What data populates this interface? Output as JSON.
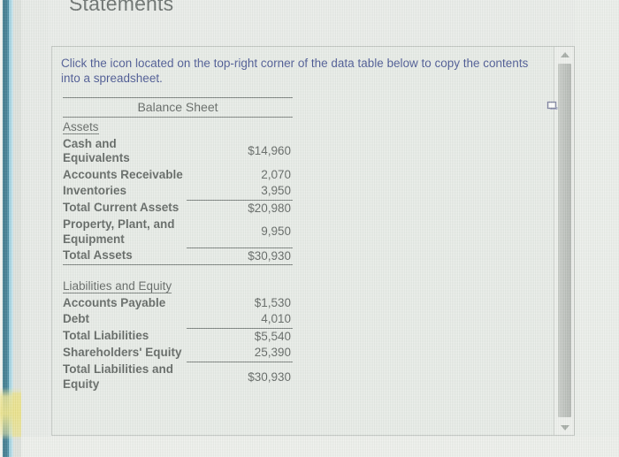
{
  "page_title": "Statements",
  "instruction": "Click the icon located on the top-right corner of the data table below to copy the contents into a spreadsheet.",
  "copy_icon": {
    "name": "copy-to-spreadsheet-icon",
    "tooltip": "Copy to spreadsheet"
  },
  "scrollbar": {
    "up_arrow": "▲",
    "down_arrow": "▼"
  },
  "colors": {
    "background": "#e5e9e4",
    "panel_border": "#b9bdb8",
    "instruction_text": "#2e3d82",
    "table_text": "#4a4f4c",
    "rule": "#6a706c",
    "edge_dark_blue": "#1d6179",
    "edge_light_blue": "#a9d7e5",
    "highlight_yellow": "#e9de78"
  },
  "table": {
    "title": "Balance Sheet",
    "sections": [
      {
        "header": "Assets",
        "rows": [
          {
            "label": "Cash and Equivalents",
            "value": "$14,960"
          },
          {
            "label": "Accounts Receivable",
            "value": "2,070"
          },
          {
            "label": "Inventories",
            "value": "3,950"
          },
          {
            "label": "Total Current Assets",
            "value": "$20,980"
          },
          {
            "label": "Property, Plant, and Equipment",
            "value": "9,950"
          },
          {
            "label": "Total Assets",
            "value": "$30,930"
          }
        ]
      },
      {
        "header": "Liabilities and Equity",
        "rows": [
          {
            "label": "Accounts Payable",
            "value": "$1,530"
          },
          {
            "label": "Debt",
            "value": "4,010"
          },
          {
            "label": "Total Liabilities",
            "value": "$5,540"
          },
          {
            "label": "Shareholders' Equity",
            "value": "25,390"
          },
          {
            "label": "Total Liabilities and Equity",
            "value": "$30,930"
          }
        ]
      }
    ]
  }
}
